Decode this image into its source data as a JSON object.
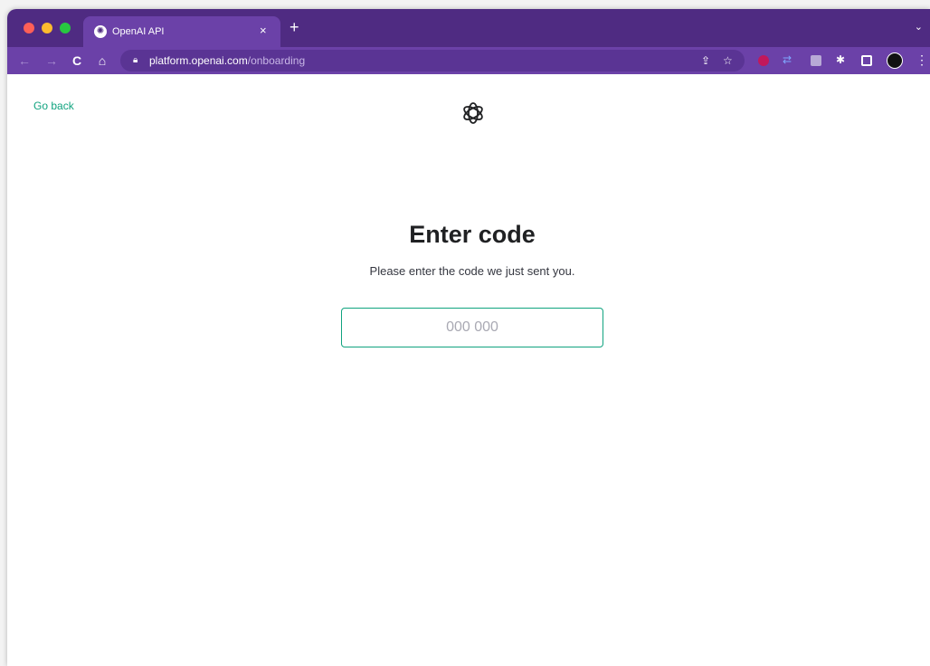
{
  "browser": {
    "tab": {
      "title": "OpenAI API",
      "favicon": "openai-icon",
      "close_glyph": "×"
    },
    "new_tab_glyph": "+",
    "dropdown_glyph": "⌄",
    "nav": {
      "back_glyph": "←",
      "forward_glyph": "→",
      "reload_glyph": "C",
      "home_glyph": "⌂"
    },
    "address": {
      "host": "platform.openai.com",
      "path": "/onboarding"
    },
    "colors": {
      "tabbar": "#4f2b82",
      "toolbar": "#6b41a8"
    }
  },
  "page": {
    "go_back_label": "Go back",
    "heading": "Enter code",
    "subtitle": "Please enter the code we just sent you.",
    "code_input": {
      "placeholder": "000 000",
      "value": ""
    },
    "accent_color": "#10a37f"
  }
}
